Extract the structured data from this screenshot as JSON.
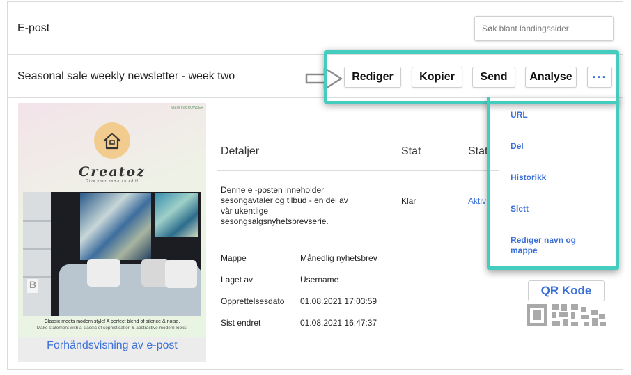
{
  "header": {
    "title": "E-post",
    "search_placeholder": "Søk blant landingssider"
  },
  "newsletter": {
    "title": "Seasonal sale weekly newsletter - week two"
  },
  "actions": {
    "edit": "Rediger",
    "copy": "Kopier",
    "send": "Send",
    "analyse": "Analyse",
    "more": "···"
  },
  "dropdown": {
    "items": [
      "URL",
      "Del",
      "Historikk",
      "Slett",
      "Rediger navn og mappe"
    ]
  },
  "preview": {
    "brand": "Creatoz",
    "tagline": "Give your home an edit!",
    "caption_main": "Classic meets modern style! A perfect blend of silence & noise.",
    "caption_sub": "Make statement with a classic of sophistication & abstractive modern looks!",
    "link": "Forhåndsvisning av e-post"
  },
  "table": {
    "headers": [
      "Detaljer",
      "Stat",
      "Stat"
    ],
    "description": "Denne e -posten inneholder sesongavtaler og tilbud - en del av vår ukentlige sesongsalgsnyhetsbrevserie.",
    "status": "Klar",
    "status_link": "Aktiv"
  },
  "meta": [
    {
      "label": "Mappe",
      "value": "Månedlig nyhetsbrev"
    },
    {
      "label": "Laget av",
      "value": "Username"
    },
    {
      "label": "Opprettelsesdato",
      "value": "01.08.2021 17:03:59"
    },
    {
      "label": "Sist endret",
      "value": "01.08.2021 16:47:37"
    }
  ],
  "qr": {
    "label": "QR Kode"
  },
  "colors": {
    "accent": "#3a6fd8",
    "highlight": "#44cdbf",
    "border": "#d9d9d9"
  },
  "icons": [
    "arrow-right-icon",
    "house-logo-icon",
    "qr-code-icon",
    "more-dots-icon"
  ]
}
